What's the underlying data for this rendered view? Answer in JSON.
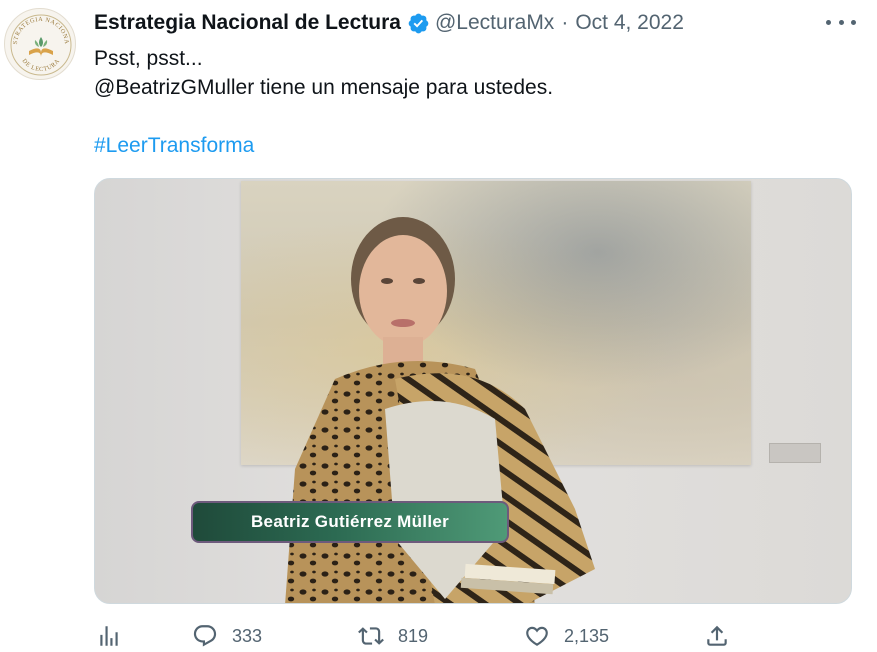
{
  "tweet": {
    "author_name": "Estrategia Nacional de Lectura",
    "handle": "@LecturaMx",
    "separator": "·",
    "date": "Oct 4, 2022",
    "avatar_text_top": "ESTRATEGIA NACIONAL",
    "avatar_text_bottom": "DE LECTURA",
    "text_line1": "Psst, psst...",
    "text_line2": "@BeatrizGMuller tiene un mensaje para ustedes.",
    "hashtag": "#LeerTransforma",
    "media_caption": "Beatriz Gutiérrez Müller"
  },
  "actions": {
    "replies": "333",
    "retweets": "819",
    "likes": "2,135"
  },
  "colors": {
    "verified": "#1d9bf0",
    "link": "#1d9bf0",
    "secondary_text": "#536471",
    "caption_green": "#2c6a52"
  },
  "icons": [
    "verified-badge-icon",
    "more-icon",
    "analytics-icon",
    "reply-icon",
    "retweet-icon",
    "like-icon",
    "share-icon"
  ]
}
